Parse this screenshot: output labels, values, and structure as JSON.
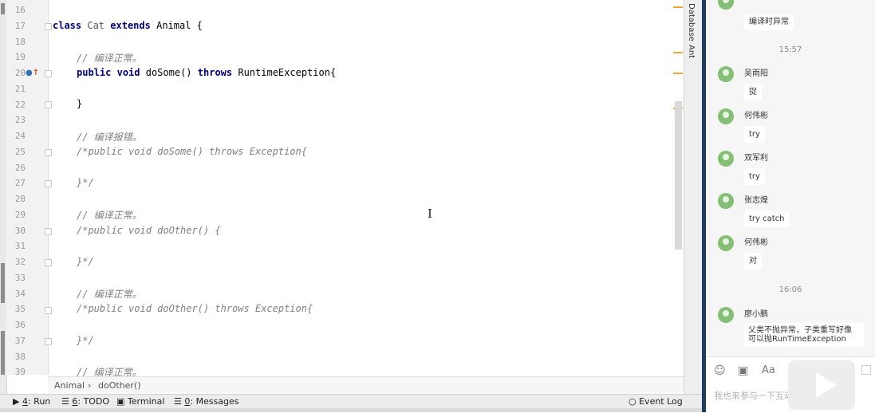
{
  "editor": {
    "lines": [
      {
        "num": "16",
        "text": ""
      },
      {
        "num": "17",
        "text": "class Cat extends Animal {"
      },
      {
        "num": "18",
        "text": ""
      },
      {
        "num": "19",
        "text": "    // 编译正常。"
      },
      {
        "num": "20",
        "text": "    public void doSome() throws RuntimeException{"
      },
      {
        "num": "21",
        "text": ""
      },
      {
        "num": "22",
        "text": "    }"
      },
      {
        "num": "23",
        "text": ""
      },
      {
        "num": "24",
        "text": "    // 编译报错。"
      },
      {
        "num": "25",
        "text": "    /*public void doSome() throws Exception{"
      },
      {
        "num": "26",
        "text": ""
      },
      {
        "num": "27",
        "text": "    }*/"
      },
      {
        "num": "28",
        "text": ""
      },
      {
        "num": "29",
        "text": "    // 编译正常。"
      },
      {
        "num": "30",
        "text": "    /*public void doOther() {"
      },
      {
        "num": "31",
        "text": ""
      },
      {
        "num": "32",
        "text": "    }*/"
      },
      {
        "num": "33",
        "text": ""
      },
      {
        "num": "34",
        "text": "    // 编译正常。"
      },
      {
        "num": "35",
        "text": "    /*public void doOther() throws Exception{"
      },
      {
        "num": "36",
        "text": ""
      },
      {
        "num": "37",
        "text": "    }*/"
      },
      {
        "num": "38",
        "text": ""
      },
      {
        "num": "39",
        "text": "    // 编译正常。"
      }
    ],
    "code": {
      "class_kw": "class",
      "class_name": "Cat",
      "extends_kw": "extends",
      "parent_rest": "Animal {",
      "public_kw": "public",
      "void_kw": "void",
      "method_name": "doSome()",
      "throws_kw": "throws",
      "exception_rest": "RuntimeException{",
      "close_brace": "}",
      "c19": "// 编译正常。",
      "c24": "// 编译报错。",
      "c25": "/*public void doSome() throws Exception{",
      "c27": "}*/",
      "c29": "// 编译正常。",
      "c30": "/*public void doOther() {",
      "c32": "}*/",
      "c34": "// 编译正常。",
      "c35": "/*public void doOther() throws Exception{",
      "c37": "}*/",
      "c39": "// 编译正常。"
    }
  },
  "breadcrumb": {
    "class": "Animal",
    "separator": "›",
    "method": "doOther()"
  },
  "right_tabs": {
    "database": "Database",
    "ant": "Ant"
  },
  "toolbar": {
    "run_num": "4",
    "run": ": Run",
    "todo_num": "6",
    "todo": ": TODO",
    "terminal": "Terminal",
    "messages_num": "0",
    "messages": ": Messages",
    "event_log": "Event Log"
  },
  "chat": {
    "top_bubble": "编译时异常",
    "time1": "15:57",
    "messages": [
      {
        "name": "吴雨阳",
        "text": "捉"
      },
      {
        "name": "何伟彬",
        "text": "try"
      },
      {
        "name": "双军利",
        "text": "try"
      },
      {
        "name": "张志煌",
        "text": "try catch"
      },
      {
        "name": "何伟彬",
        "text": "对"
      }
    ],
    "time2": "16:06",
    "last_name": "廖小鹏",
    "last_text_1": "父类不抛异常，子类重写好像",
    "last_text_2": "可以抛RunTimeException",
    "input_placeholder": "我也来参与一下互动",
    "font_icon_label": "Aa"
  },
  "colors": {
    "keyword": "#000080",
    "comment": "#808080",
    "chat_divider": "#1d3c5e",
    "avatar": "#85bf76",
    "marker": "#f0a732"
  }
}
